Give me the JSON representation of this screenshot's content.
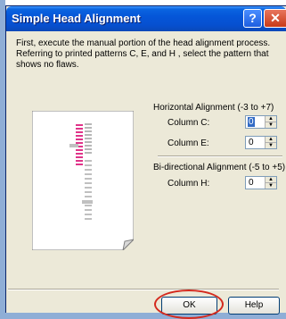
{
  "dialog": {
    "title": "Simple Head Alignment",
    "instructions": "First, execute the manual portion of the head alignment process. Referring to printed patterns C, E, and H , select the pattern that shows no flaws."
  },
  "title_buttons": {
    "help_glyph": "?",
    "close_glyph": "✕"
  },
  "horizontal": {
    "heading": "Horizontal Alignment (-3 to +7)",
    "column_c": {
      "label": "Column C:",
      "value": "0"
    },
    "column_e": {
      "label": "Column E:",
      "value": "0"
    }
  },
  "bidirectional": {
    "heading": "Bi-directional Alignment (-5 to +5)",
    "column_h": {
      "label": "Column H:",
      "value": "0"
    }
  },
  "buttons": {
    "ok": "OK",
    "help": "Help"
  },
  "colors": {
    "highlight_pattern": "#e0348a",
    "annotation_circle": "#d42a1e",
    "title_bar": "#0556d8"
  }
}
